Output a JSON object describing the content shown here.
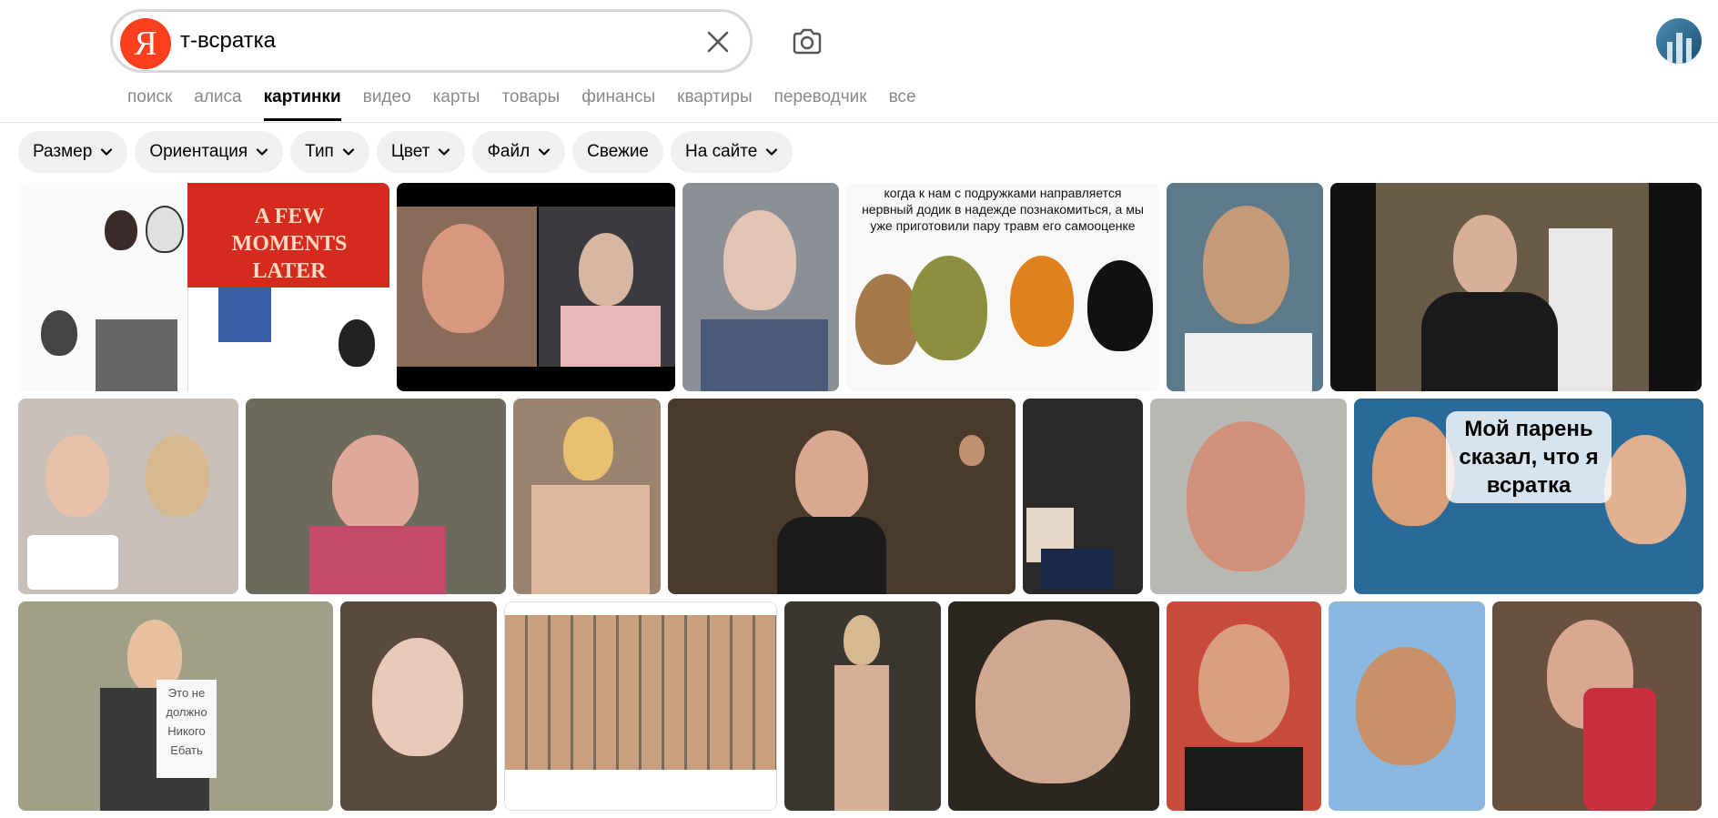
{
  "search": {
    "query": "т-всратка",
    "logo_letter": "Я"
  },
  "icons": {
    "clear": "close-icon",
    "camera": "camera-icon",
    "chevron": "chevron-down-icon"
  },
  "tabs": [
    {
      "label": "поиск",
      "active": false
    },
    {
      "label": "алиса",
      "active": false
    },
    {
      "label": "картинки",
      "active": true
    },
    {
      "label": "видео",
      "active": false
    },
    {
      "label": "карты",
      "active": false
    },
    {
      "label": "товары",
      "active": false
    },
    {
      "label": "финансы",
      "active": false
    },
    {
      "label": "квартиры",
      "active": false
    },
    {
      "label": "переводчик",
      "active": false
    },
    {
      "label": "все",
      "active": false
    }
  ],
  "filters": [
    {
      "label": "Размер",
      "has_dropdown": true
    },
    {
      "label": "Ориентация",
      "has_dropdown": true
    },
    {
      "label": "Тип",
      "has_dropdown": true
    },
    {
      "label": "Цвет",
      "has_dropdown": true
    },
    {
      "label": "Файл",
      "has_dropdown": true
    },
    {
      "label": "Свежие",
      "has_dropdown": false
    },
    {
      "label": "На сайте",
      "has_dropdown": true
    }
  ],
  "colors": {
    "accent": "#fc3f1d",
    "chip_bg": "#f0f0f0",
    "tab_inactive": "#8a8a8a"
  },
  "results": {
    "meme_few_moments": "A FEW MOMENTS LATER",
    "meme_podruzhki": "когда к нам с подружками направляется нервный додик в надежде познакомиться, а мы уже приготовили пару травм его самооценке",
    "meme_paren": "Мой парень сказал, что я всратка",
    "sign_text": "Это не должно Никого Ебать"
  }
}
